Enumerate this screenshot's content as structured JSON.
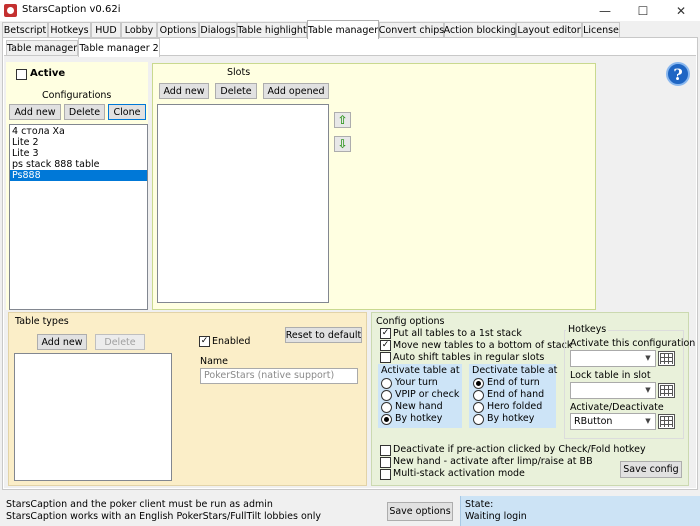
{
  "window": {
    "title": "StarsCaption v0.62i",
    "minimize_glyph": "—",
    "maximize_glyph": "☐",
    "close_glyph": "✕"
  },
  "main_tabs": [
    "Betscript",
    "Hotkeys",
    "HUD",
    "Lobby",
    "Options",
    "Dialogs",
    "Table highlight",
    "Table manager",
    "Convert chips",
    "Action blocking",
    "Layout editor",
    "License"
  ],
  "main_tabs_active": "Table manager",
  "sub_tabs": [
    "Table manager",
    "Table manager 2"
  ],
  "sub_tabs_active": "Table manager 2",
  "help_glyph": "?",
  "configurations": {
    "active_label": "Active",
    "active_checked": false,
    "title": "Configurations",
    "add_new": "Add new",
    "delete": "Delete",
    "clone": "Clone",
    "items": [
      "4 стола Ха",
      "Lite 2",
      "Lite 3",
      "ps stack 888 table",
      "Ps888"
    ],
    "selected": "Ps888"
  },
  "slots": {
    "title": "Slots",
    "add_new": "Add new",
    "delete": "Delete",
    "add_opened": "Add opened",
    "up_glyph": "⇧",
    "down_glyph": "⇩"
  },
  "table_types": {
    "title": "Table types",
    "add_new": "Add new",
    "delete": "Delete",
    "enabled_label": "Enabled",
    "enabled_checked": true,
    "reset_label": "Reset to default",
    "name_label": "Name",
    "name_value": "PokerStars (native support)"
  },
  "config_options": {
    "title": "Config options",
    "checks": [
      {
        "label": "Put all tables to a 1st stack",
        "checked": true
      },
      {
        "label": "Move new tables to a bottom of stack",
        "checked": true
      },
      {
        "label": "Auto shift tables in regular slots",
        "checked": false
      }
    ],
    "activate_group": {
      "title": "Activate table at",
      "options": [
        "Your turn",
        "VPIP or check",
        "New hand",
        "By hotkey"
      ],
      "selected": "By hotkey"
    },
    "deactivate_group": {
      "title": "Dectivate table at",
      "options": [
        "End of turn",
        "End of hand",
        "Hero folded",
        "By hotkey"
      ],
      "selected": "End of turn"
    },
    "bottom_checks": [
      {
        "label": "Deactivate if pre-action clicked by Check/Fold hotkey",
        "checked": false
      },
      {
        "label": "New hand - activate after limp/raise at BB",
        "checked": false
      },
      {
        "label": "Multi-stack activation mode",
        "checked": false
      }
    ],
    "save_config": "Save config"
  },
  "hotkeys": {
    "title": "Hotkeys",
    "activate_config_label": "Activate this configuration",
    "activate_config_value": "",
    "lock_slot_label": "Lock table in slot",
    "lock_slot_value": "",
    "activate_deactivate_label": "Activate/Deactivate",
    "activate_deactivate_value": "RButton"
  },
  "status": {
    "line1": "StarsCaption and the poker client must be run as admin",
    "line2": "StarsCaption works with an English PokerStars/FullTilt lobbies only",
    "save_options": "Save options",
    "state_label": "State:",
    "state_value": "Waiting login"
  }
}
